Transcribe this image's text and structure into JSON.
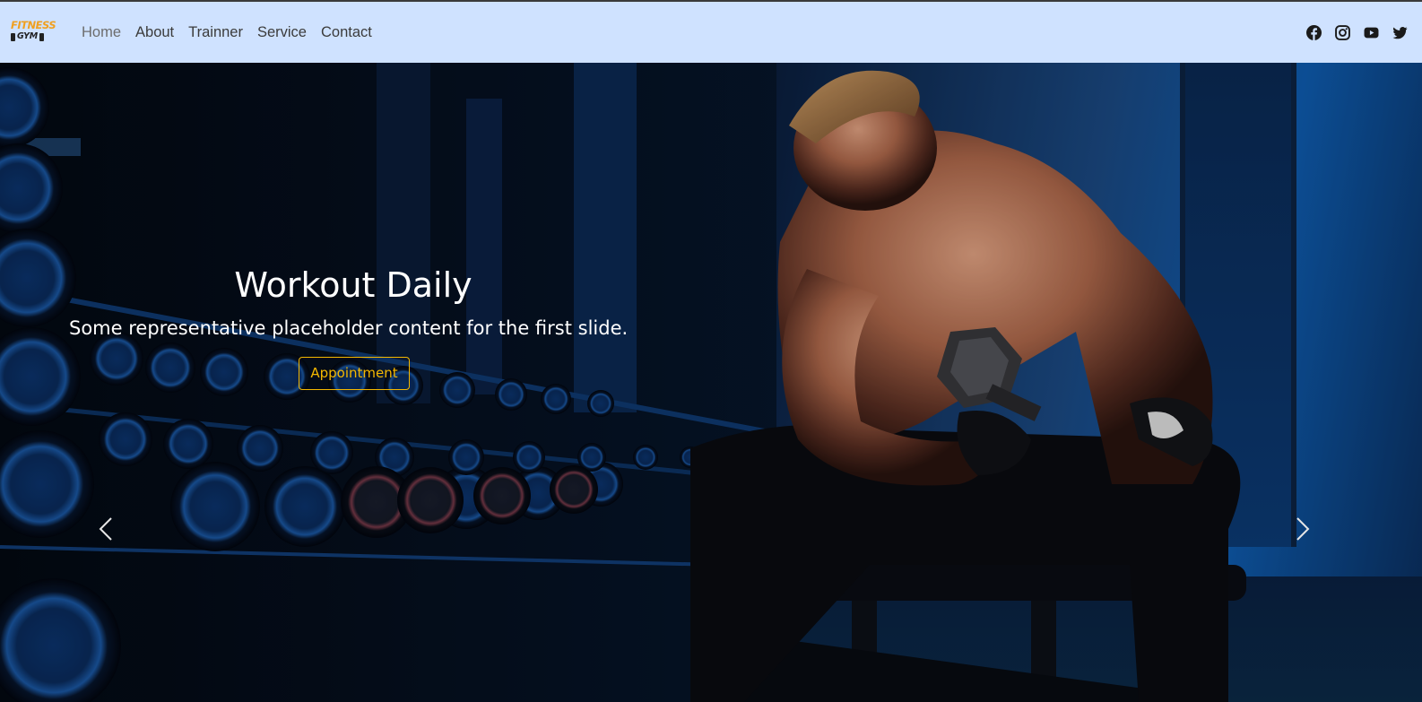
{
  "brand": {
    "line1": "FITNESS",
    "line2": "GYM"
  },
  "nav": {
    "items": [
      {
        "label": "Home",
        "active": true
      },
      {
        "label": "About",
        "active": false
      },
      {
        "label": "Trainner",
        "active": false
      },
      {
        "label": "Service",
        "active": false
      },
      {
        "label": "Contact",
        "active": false
      }
    ]
  },
  "social": [
    "facebook-icon",
    "instagram-icon",
    "youtube-icon",
    "twitter-icon"
  ],
  "carousel": {
    "title": "Workout Daily",
    "text": "Some representative placeholder content for the first slide.",
    "button": "Appointment",
    "prev_icon": "chevron-left-icon",
    "next_icon": "chevron-right-icon"
  },
  "colors": {
    "navbar_bg": "#cfe2ff",
    "accent": "#f5b800",
    "brand_orange": "#f0a020"
  }
}
